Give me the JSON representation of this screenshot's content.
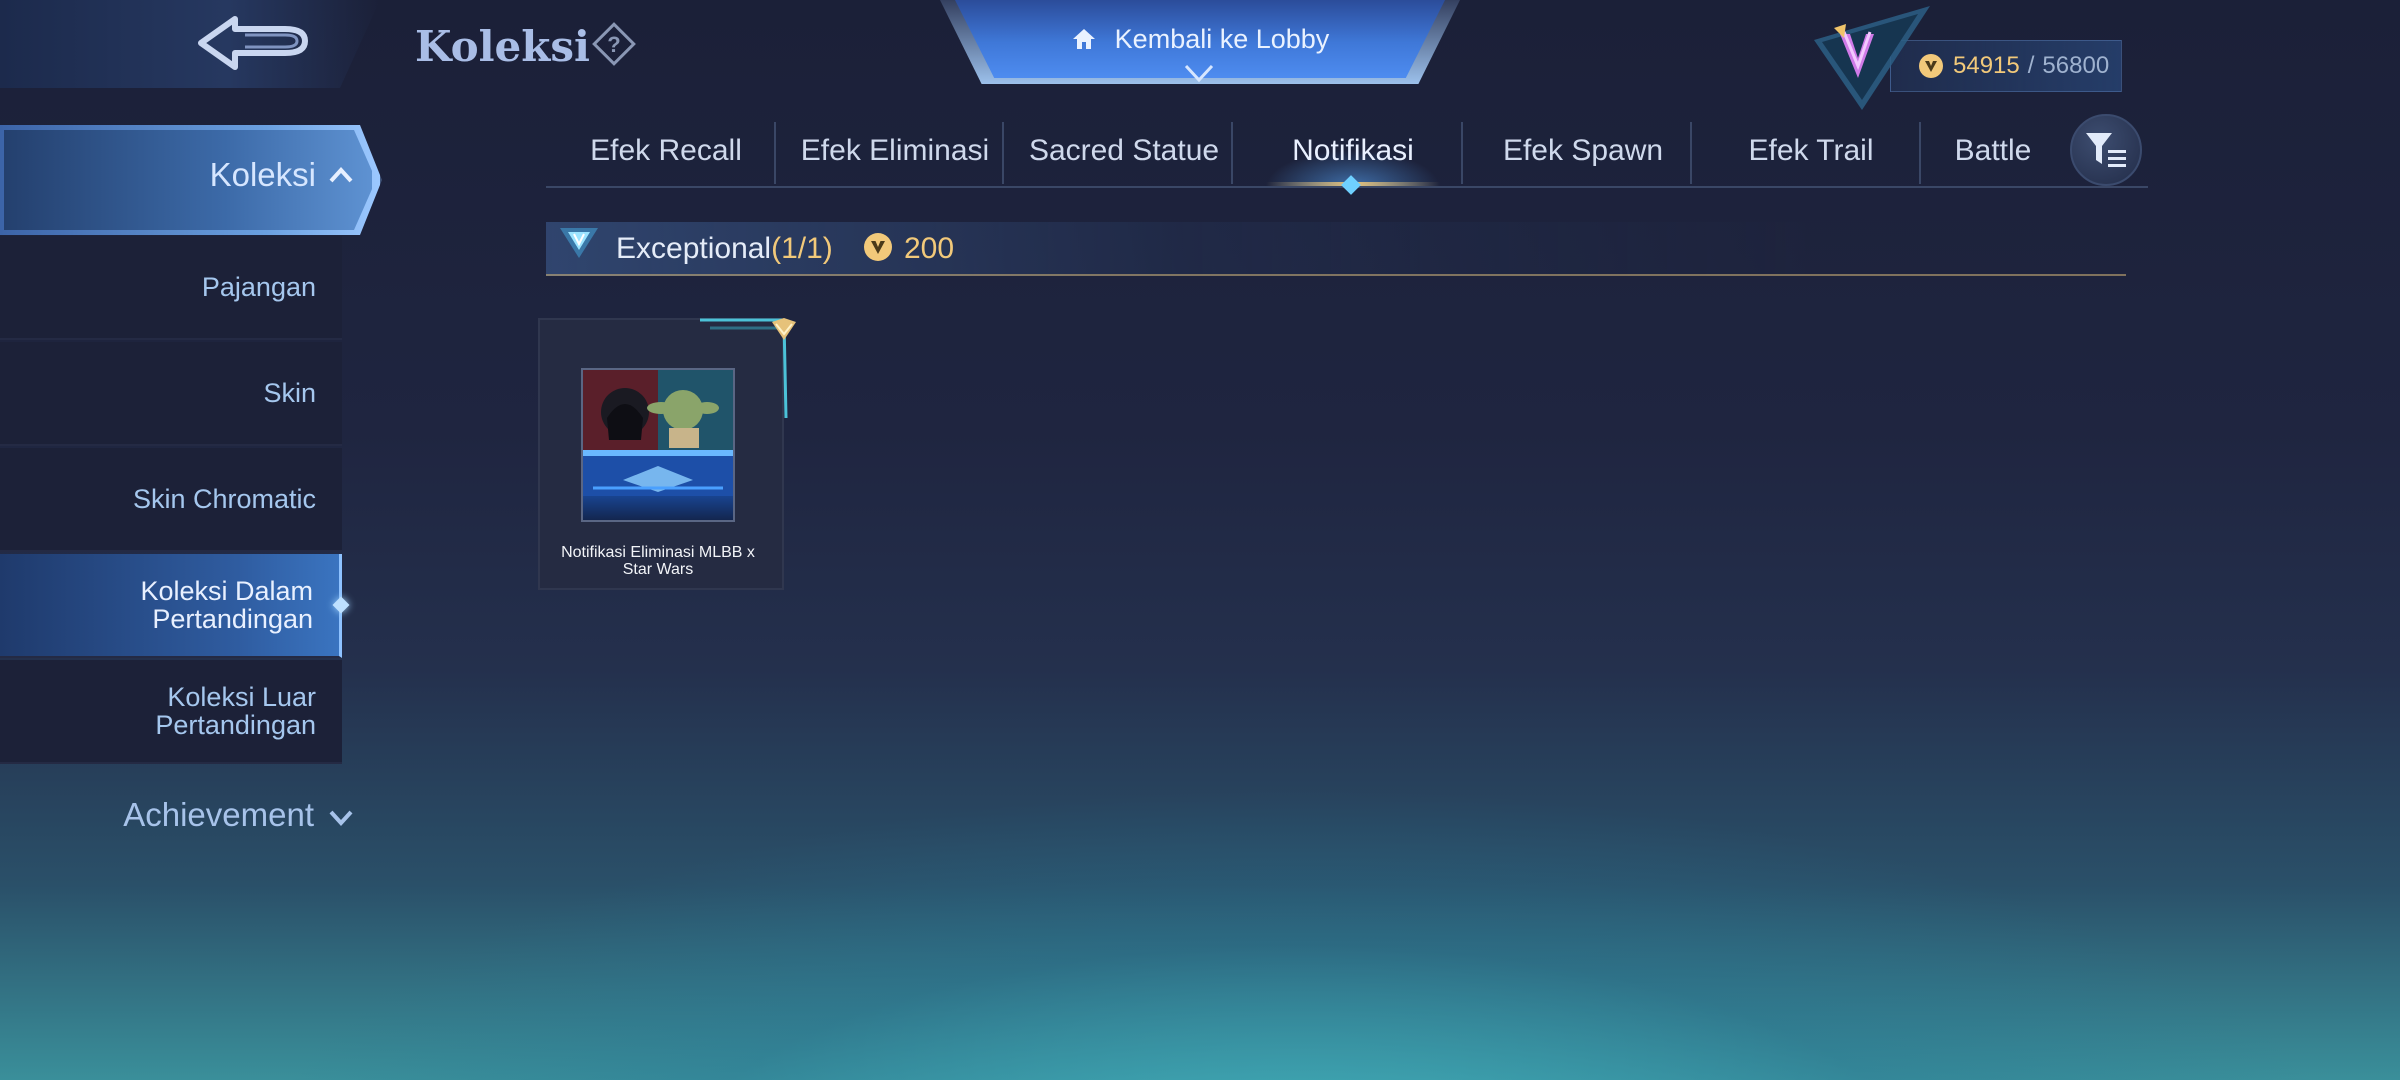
{
  "header": {
    "title": "Koleksi",
    "lobby_button": "Kembali ke Lobby"
  },
  "points": {
    "current": "54915",
    "separator": "/",
    "max": "56800"
  },
  "sidebar": {
    "active_section": "Koleksi",
    "items": [
      {
        "label": "Pajangan"
      },
      {
        "label": "Skin"
      },
      {
        "label": "Skin Chromatic"
      },
      {
        "label": "Koleksi Dalam Pertandingan",
        "selected": true
      },
      {
        "label": "Koleksi Luar Pertandingan"
      }
    ],
    "achievement": "Achievement"
  },
  "tabs": [
    {
      "label": "Efek Recall"
    },
    {
      "label": "Efek Eliminasi"
    },
    {
      "label": "Sacred Statue"
    },
    {
      "label": "Notifikasi",
      "active": true
    },
    {
      "label": "Efek Spawn"
    },
    {
      "label": "Efek Trail"
    },
    {
      "label": "Battle"
    }
  ],
  "section": {
    "tier": "Exceptional",
    "count": "(1/1)",
    "points": "200"
  },
  "items": [
    {
      "title": "Notifikasi Eliminasi MLBB x Star Wars"
    }
  ],
  "colors": {
    "gold": "#f2c97a",
    "accent_blue": "#6aa0e0",
    "text_blue": "#a5c7ee"
  },
  "icons": {
    "back": "back-arrow-icon",
    "help": "question-diamond-icon",
    "home": "home-icon",
    "rank": "rank-emblem-icon",
    "coin": "collector-coin-icon",
    "filter": "filter-icon"
  }
}
